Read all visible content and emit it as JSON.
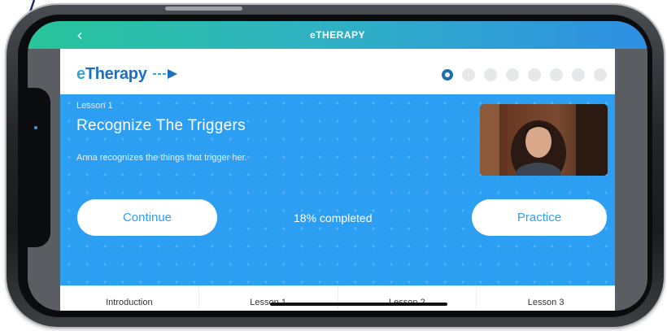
{
  "statusbar": {
    "title": "eTHERAPY",
    "back_icon": "chevron-left-icon"
  },
  "brand": {
    "logo_prefix": "e",
    "logo_rest": "Therapy",
    "arrow_icon": "arrow-right-icon"
  },
  "progress": {
    "total_steps": 8,
    "current_step": 1
  },
  "lesson": {
    "number_label": "Lesson 1",
    "title": "Recognize The Triggers",
    "description": "Anna recognizes the things that trigger her.",
    "completion_text": "18% completed",
    "continue_label": "Continue",
    "practice_label": "Practice"
  },
  "tabs": [
    {
      "label": "Introduction"
    },
    {
      "label": "Lesson 1"
    },
    {
      "label": "Lesson 2"
    },
    {
      "label": "Lesson 3"
    }
  ],
  "colors": {
    "accent_blue": "#2d9ff3",
    "brand_navy": "#1d6fc0",
    "status_gradient_start": "#27c59a",
    "status_gradient_end": "#2f8fe3"
  }
}
